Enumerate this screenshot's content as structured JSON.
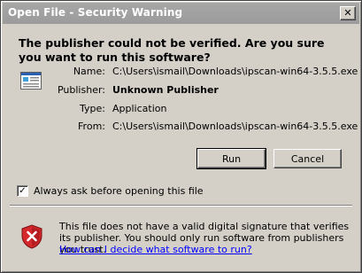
{
  "window": {
    "title": "Open File - Security Warning",
    "close_glyph": "✕"
  },
  "heading": "The publisher could not be verified.  Are you sure you want to run this software?",
  "details": {
    "name_label": "Name:",
    "name_value": "C:\\Users\\ismail\\Downloads\\ipscan-win64-3.5.5.exe",
    "publisher_label": "Publisher:",
    "publisher_value": "Unknown Publisher",
    "type_label": "Type:",
    "type_value": "Application",
    "from_label": "From:",
    "from_value": "C:\\Users\\ismail\\Downloads\\ipscan-win64-3.5.5.exe"
  },
  "buttons": {
    "run_label": "Run",
    "cancel_label": "Cancel"
  },
  "checkbox": {
    "label": "Always ask before opening this file",
    "checked": true,
    "mark": "✓"
  },
  "warning": {
    "text": "This file does not have a valid digital signature that verifies its publisher.  You should only run software from publishers you trust.",
    "link_text": "How can I decide what software to run?"
  },
  "icons": {
    "file": "application-file-icon",
    "shield": "security-shield-error-icon"
  },
  "colors": {
    "titlebar": "#a0a0a0",
    "dialog_bg": "#d4d0c8",
    "link": "#0000ff",
    "shield_red": "#d4282c"
  }
}
